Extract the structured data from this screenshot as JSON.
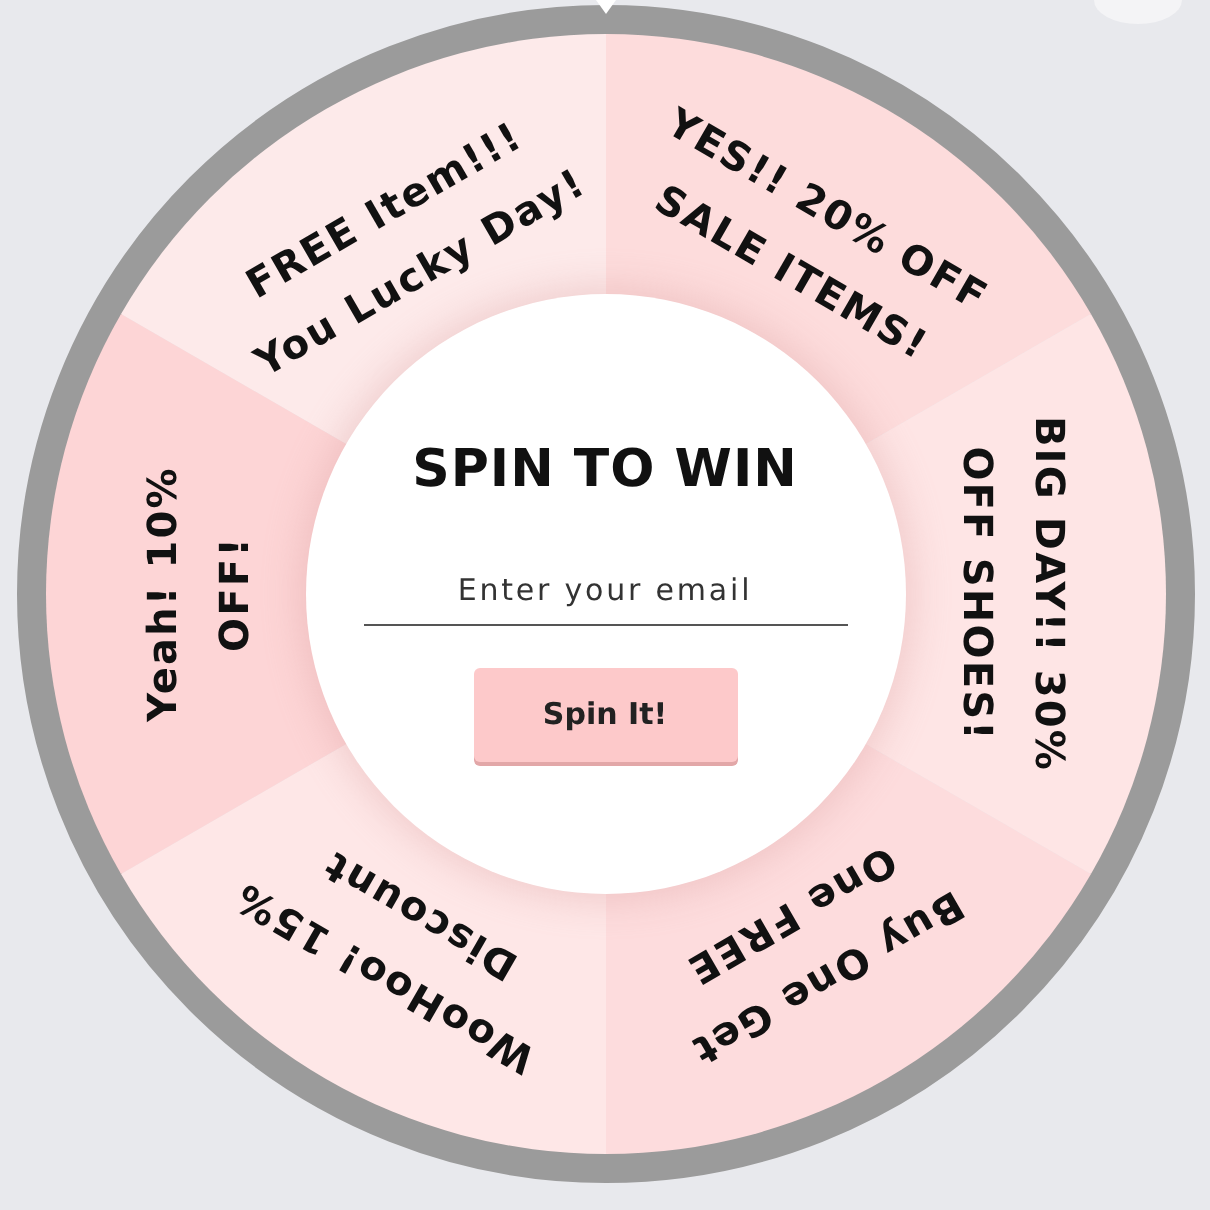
{
  "wheel": {
    "segments": [
      {
        "lines": [
          "FREE Item!!!",
          "You Lucky Day!"
        ],
        "color": "#fdeaea"
      },
      {
        "lines": [
          "YES!! 20% OFF",
          "SALE ITEMS!"
        ],
        "color": "#fddcdc"
      },
      {
        "lines": [
          "BIG DAY!! 30%",
          "OFF SHOES!"
        ],
        "color": "#fee5e5"
      },
      {
        "lines": [
          "Buy One Get",
          "One FREE"
        ],
        "color": "#fddcdd"
      },
      {
        "lines": [
          "WooHoo! 15%",
          "Discount"
        ],
        "color": "#fee7e7"
      },
      {
        "lines": [
          "Yeah! 10%",
          "OFF!"
        ],
        "color": "#fdd5d6"
      }
    ]
  },
  "panel": {
    "title": "SPIN TO WIN",
    "email": {
      "placeholder": "Enter your email"
    },
    "button": "Spin It!"
  }
}
